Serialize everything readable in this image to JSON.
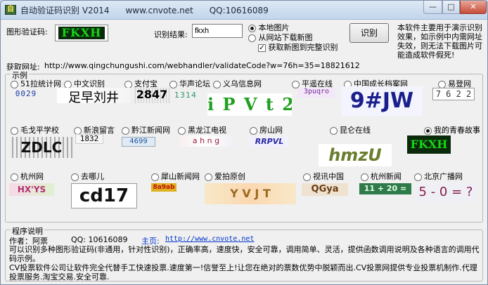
{
  "window": {
    "title": "自动验证码识别 V2014      www.cnvote.net      QQ:10616089",
    "icon_text": "自",
    "minimize_glyph": "—",
    "maximize_glyph": "□",
    "close_glyph": "✕"
  },
  "top": {
    "captcha_label": "图形验证码:",
    "captcha_text": "FKXH",
    "result_label": "识别结果:",
    "result_value": "fkxh",
    "radio_local": "本地图片",
    "radio_web": "从网站下载新图",
    "checkbox_full": "获取新图到完整识别",
    "recognize_button": "识别",
    "description": "本软件主要用于演示识别效果，如示例中内需网址失效，则无法下载图片可能造成软件假死!",
    "url_label": "获取网址:",
    "url_value": "http://www.qingchungushi.com/webhandler/validateCode?w=76h=35=18821612"
  },
  "examples": {
    "legend": "示例",
    "row1": [
      {
        "label": "51拉统计网",
        "captcha": "0029"
      },
      {
        "label": "中文识别",
        "captcha": "足早刘井"
      },
      {
        "label": "支付宝",
        "captcha": "2847"
      },
      {
        "label": "华声论坛",
        "captcha": "1314"
      },
      {
        "label": "义乌信息网",
        "captcha": "i P V t 2"
      },
      {
        "label": "平遥在线",
        "captcha": "3puqro"
      },
      {
        "label": "中国成长档案网",
        "captcha": "9#JW"
      },
      {
        "label": "易登网",
        "captcha": "7 6 2 2"
      }
    ],
    "row2": [
      {
        "label": "毛戈平学校",
        "captcha": "ZDLC"
      },
      {
        "label": "新浪留言",
        "captcha": "1832"
      },
      {
        "label": "黔江新闻网",
        "captcha": "4699"
      },
      {
        "label": "黑龙江电视",
        "captcha": "a  h n g"
      },
      {
        "label": "房山网",
        "captcha": "RRPVL"
      },
      {
        "label": "昆仑在线",
        "captcha": "hmzU"
      },
      {
        "label": "我的青春故事",
        "captcha": "FKXH"
      }
    ],
    "row3": [
      {
        "label": "杭州网",
        "captcha": "HX'YS"
      },
      {
        "label": "去哪儿",
        "captcha": "cd17"
      },
      {
        "label": "犀山新闻网",
        "captcha": "8a9ab"
      },
      {
        "label": "爱拍原创",
        "captcha": "Y V J T"
      },
      {
        "label": "视讯中国",
        "captcha": "QGya"
      },
      {
        "label": "杭州新闻",
        "captcha": "11 + 20 ="
      },
      {
        "label": "北京广播网",
        "captcha": "5 - 0 = ?"
      }
    ]
  },
  "program": {
    "legend": "程序说明",
    "author_label": "作者：阿票",
    "qq_label": "QQ: 10616089",
    "home_label": "主页:",
    "home_url": "http://www.cnvote.net",
    "line1": "可以识别多种图形验证码(非通用，针对性识别)，正确率高，速度快，安全可靠，调用简单、灵活，提供函数调用说明及各种语言的调用代码示例。",
    "line2": "CV投票软件公司让软件完全代替手工快速投票.速度第一!信誉至上!让您在绝对的票数优势中脱颖而出.CV投票网提供专业投票机制作.代理投票服务.淘宝交易.安全可靠."
  },
  "colors": {
    "title_bg": "#c3d6ec",
    "captcha_green": "#16d616",
    "link_blue": "#0033cc"
  }
}
